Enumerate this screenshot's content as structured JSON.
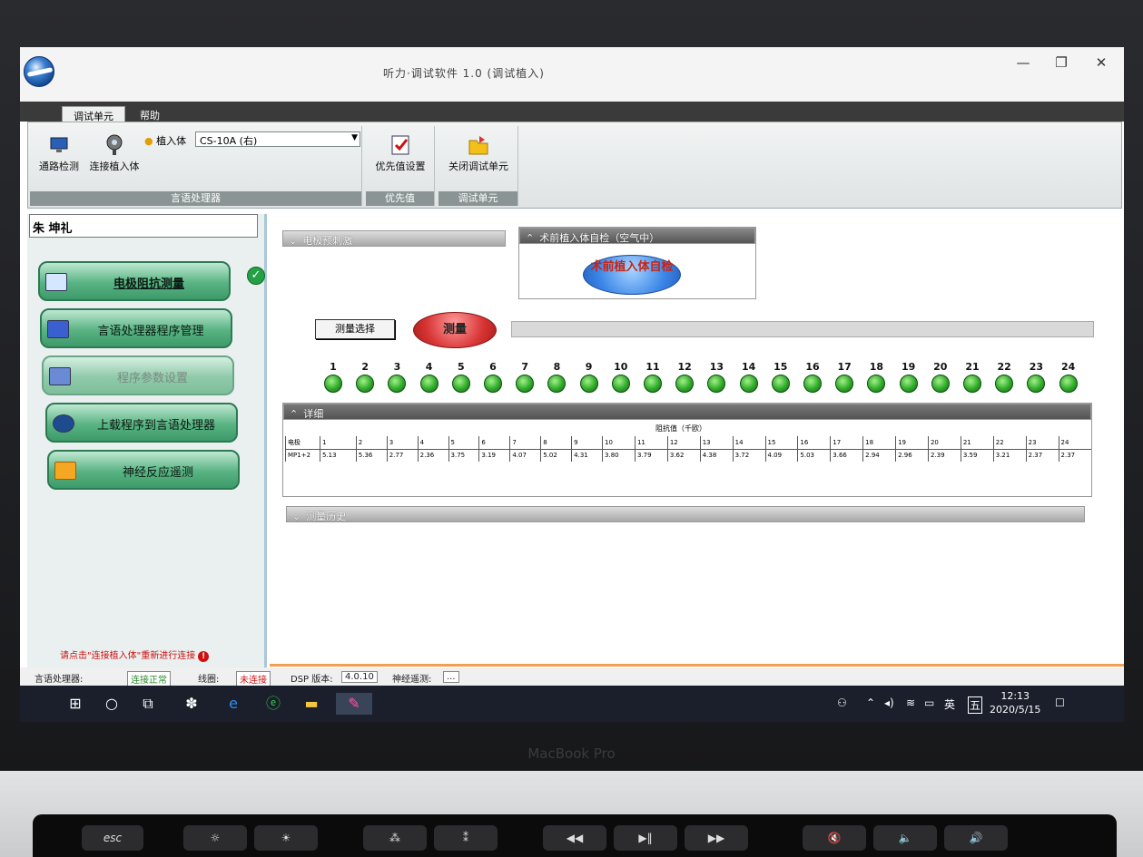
{
  "window": {
    "title": "听力·调试软件 1.0 (调试植入)",
    "minimize": "—",
    "restore": "❐",
    "close": "✕"
  },
  "ribbon": {
    "tabs": [
      "调试单元",
      "帮助"
    ],
    "groups": [
      {
        "label": "言语处理器",
        "buttons": [
          "通路检测",
          "连接植入体"
        ],
        "implant_label": "植入体",
        "implant_value": "CS-10A (右)"
      },
      {
        "label": "优先值",
        "buttons": [
          "优先值设置"
        ]
      },
      {
        "label": "调试单元",
        "buttons": [
          "关闭调试单元"
        ]
      }
    ]
  },
  "left": {
    "patient": "朱 坤礼",
    "nav": [
      "电极阻抗测量",
      "言语处理器程序管理",
      "程序参数设置",
      "上载程序到言语处理器",
      "神经反应遥测"
    ],
    "check": "✓",
    "warning": "请点击\"连接植入体\"重新进行连接",
    "warning_icon": "!"
  },
  "main": {
    "pre_stim": "电极预刺激",
    "self_test_title": "术前植入体自检（空气中）",
    "self_test_button": "术前植入体自检",
    "measure_select": "测量选择",
    "measure": "测量",
    "details": "详细",
    "history": "测量历史",
    "electrodes": [
      "1",
      "2",
      "3",
      "4",
      "5",
      "6",
      "7",
      "8",
      "9",
      "10",
      "11",
      "12",
      "13",
      "14",
      "15",
      "16",
      "17",
      "18",
      "19",
      "20",
      "21",
      "22",
      "23",
      "24"
    ],
    "table": {
      "unit": "阻抗值（千欧）",
      "head": [
        "电极",
        "1",
        "2",
        "3",
        "4",
        "5",
        "6",
        "7",
        "8",
        "9",
        "10",
        "11",
        "12",
        "13",
        "14",
        "15",
        "16",
        "17",
        "18",
        "19",
        "20",
        "21",
        "22",
        "23",
        "24"
      ],
      "row": [
        "MP1+2",
        "5.13",
        "5.36",
        "2.77",
        "2.36",
        "3.75",
        "3.19",
        "4.07",
        "5.02",
        "4.31",
        "3.80",
        "3.79",
        "3.62",
        "4.38",
        "3.72",
        "4.09",
        "5.03",
        "3.66",
        "2.94",
        "2.96",
        "2.39",
        "3.59",
        "3.21",
        "2.37",
        "2.37"
      ]
    }
  },
  "status": {
    "sp_label": "言语处理器:",
    "sp_value": "连接正常",
    "coil_label": "线圈:",
    "coil_value": "未连接",
    "dsp_label": "DSP 版本:",
    "dsp_value": "4.0.10",
    "nrt_label": "神经遥测:",
    "nrt_value": "..."
  },
  "taskbar": {
    "ime": "英",
    "ime2": "五",
    "time": "12:13",
    "date": "2020/5/15"
  },
  "laptop": {
    "brand": "MacBook Pro",
    "esc": "esc"
  }
}
